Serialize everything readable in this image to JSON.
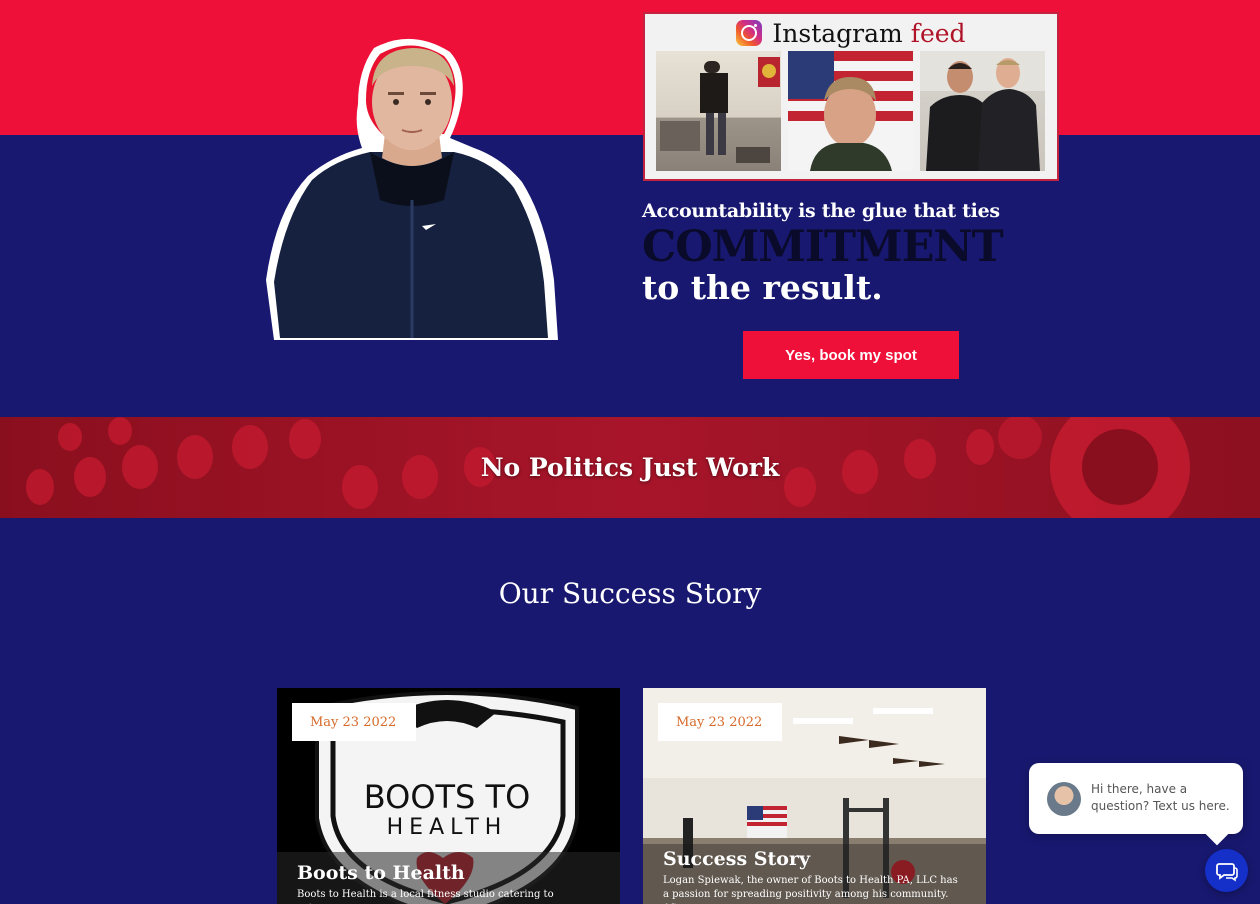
{
  "instagram": {
    "title_main": "Instagram",
    "title_accent": "feed",
    "icon": "instagram-icon",
    "photos": [
      "gym-workout-photo",
      "flag-portrait-photo",
      "two-men-gym-photo"
    ]
  },
  "hero": {
    "tagline_line1": "Accountability is the glue that ties",
    "tagline_line2": "COMMITMENT",
    "tagline_line3": "to the result.",
    "cta_label": "Yes, book my spot"
  },
  "banner": {
    "text": "No Politics Just Work"
  },
  "success": {
    "title": "Our Success Story",
    "cards": [
      {
        "date": "May 23 2022",
        "title": "Boots to Health",
        "excerpt": "Boots to Health is a local fitness studio catering to veterans",
        "logo_line1": "BOOTS TO",
        "logo_line2": "HEALTH"
      },
      {
        "date": "May 23 2022",
        "title": "Success Story",
        "excerpt": "Logan Spiewak, the owner of Boots to Health PA, LLC has a passion for spreading positivity among his community. After"
      }
    ]
  },
  "chat": {
    "message": "Hi there, have a question? Text us here.",
    "icon": "chat-icon"
  },
  "colors": {
    "navy": "#181870",
    "red": "#ee1039",
    "date_orange": "#d66a2a",
    "chat_blue": "#1530c8"
  }
}
